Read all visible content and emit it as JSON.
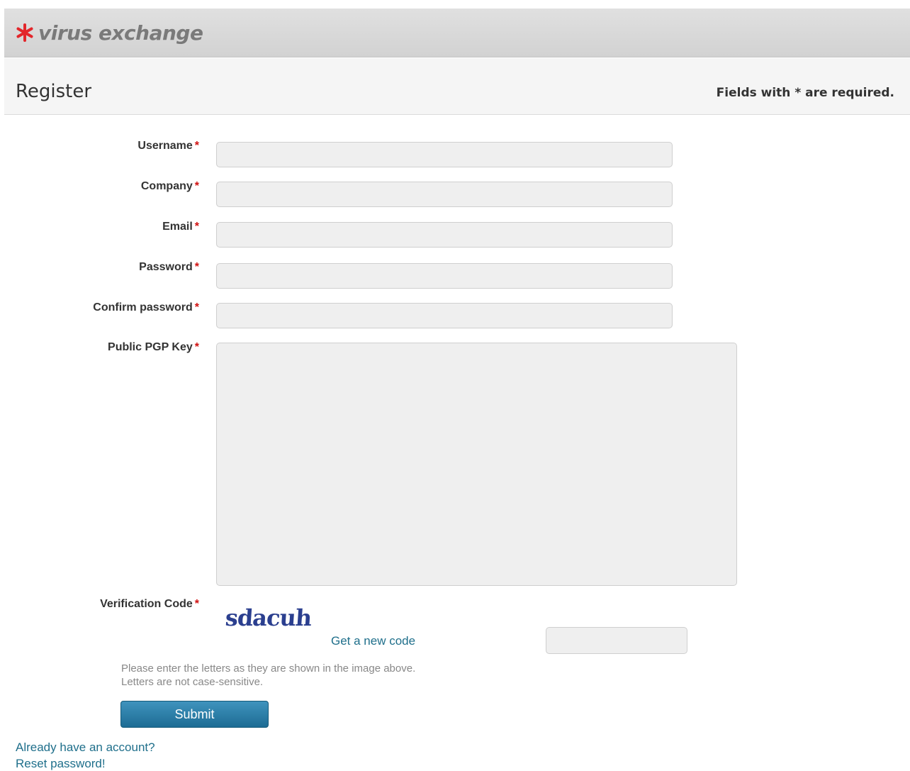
{
  "header": {
    "logo_text": "virus exchange",
    "logo_icon": "asterisk-logo-icon",
    "logo_color": "#e3262b"
  },
  "title_bar": {
    "title": "Register",
    "required_note": "Fields with * are required."
  },
  "form": {
    "required_marker": "*",
    "fields": [
      {
        "label": "Username",
        "value": "",
        "type": "text"
      },
      {
        "label": "Company",
        "value": "",
        "type": "text"
      },
      {
        "label": "Email",
        "value": "",
        "type": "text"
      },
      {
        "label": "Password",
        "value": "",
        "type": "password"
      },
      {
        "label": "Confirm password",
        "value": "",
        "type": "password"
      },
      {
        "label": "Public PGP Key",
        "value": "",
        "type": "textarea"
      }
    ],
    "verification": {
      "label": "Verification Code",
      "captcha_text": "sdacuh",
      "new_code_link": "Get a new code",
      "input_value": "",
      "hint_line1": "Please enter the letters as they are shown in the image above.",
      "hint_line2": "Letters are not case-sensitive."
    },
    "submit_label": "Submit"
  },
  "links": {
    "login": "Already have an account?",
    "reset": "Reset password!"
  },
  "colors": {
    "accent": "#1d6c94",
    "link": "#1f6f8b",
    "required": "#d01010"
  }
}
